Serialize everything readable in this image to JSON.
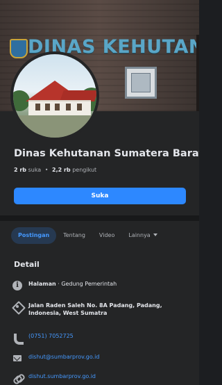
{
  "cover": {
    "sign_text": "DINAS KEHUTANAN"
  },
  "page": {
    "name": "Dinas Kehutanan Sumatera Barat",
    "likes_count": "2 rb",
    "likes_label": "suka",
    "separator": "•",
    "followers_count": "2,2 rb",
    "followers_label": "pengikut",
    "like_button": "Suka"
  },
  "tabs": [
    {
      "label": "Postingan",
      "active": true
    },
    {
      "label": "Tentang",
      "active": false
    },
    {
      "label": "Video",
      "active": false
    },
    {
      "label": "Lainnya",
      "active": false,
      "icon": "caret-down-icon"
    }
  ],
  "details": {
    "title": "Detail",
    "items": [
      {
        "icon": "info-icon",
        "prefix": "Halaman",
        "text": "Gedung Pemerintah"
      },
      {
        "icon": "location-icon",
        "text": "Jalan Raden Saleh No. 8A Padang, Padang, Indonesia, West Sumatra"
      },
      {
        "icon": "phone-icon",
        "text": "(0751) 7052725"
      },
      {
        "icon": "email-icon",
        "text": "dishut@sumbarprov.go.id"
      },
      {
        "icon": "link-icon",
        "text": "dishut.sumbarprov.go.id"
      }
    ]
  },
  "colors": {
    "background": "#242526",
    "accent": "#2d88ff",
    "link": "#4599ff",
    "text": "#e4e6eb",
    "muted": "#b0b3b8"
  }
}
